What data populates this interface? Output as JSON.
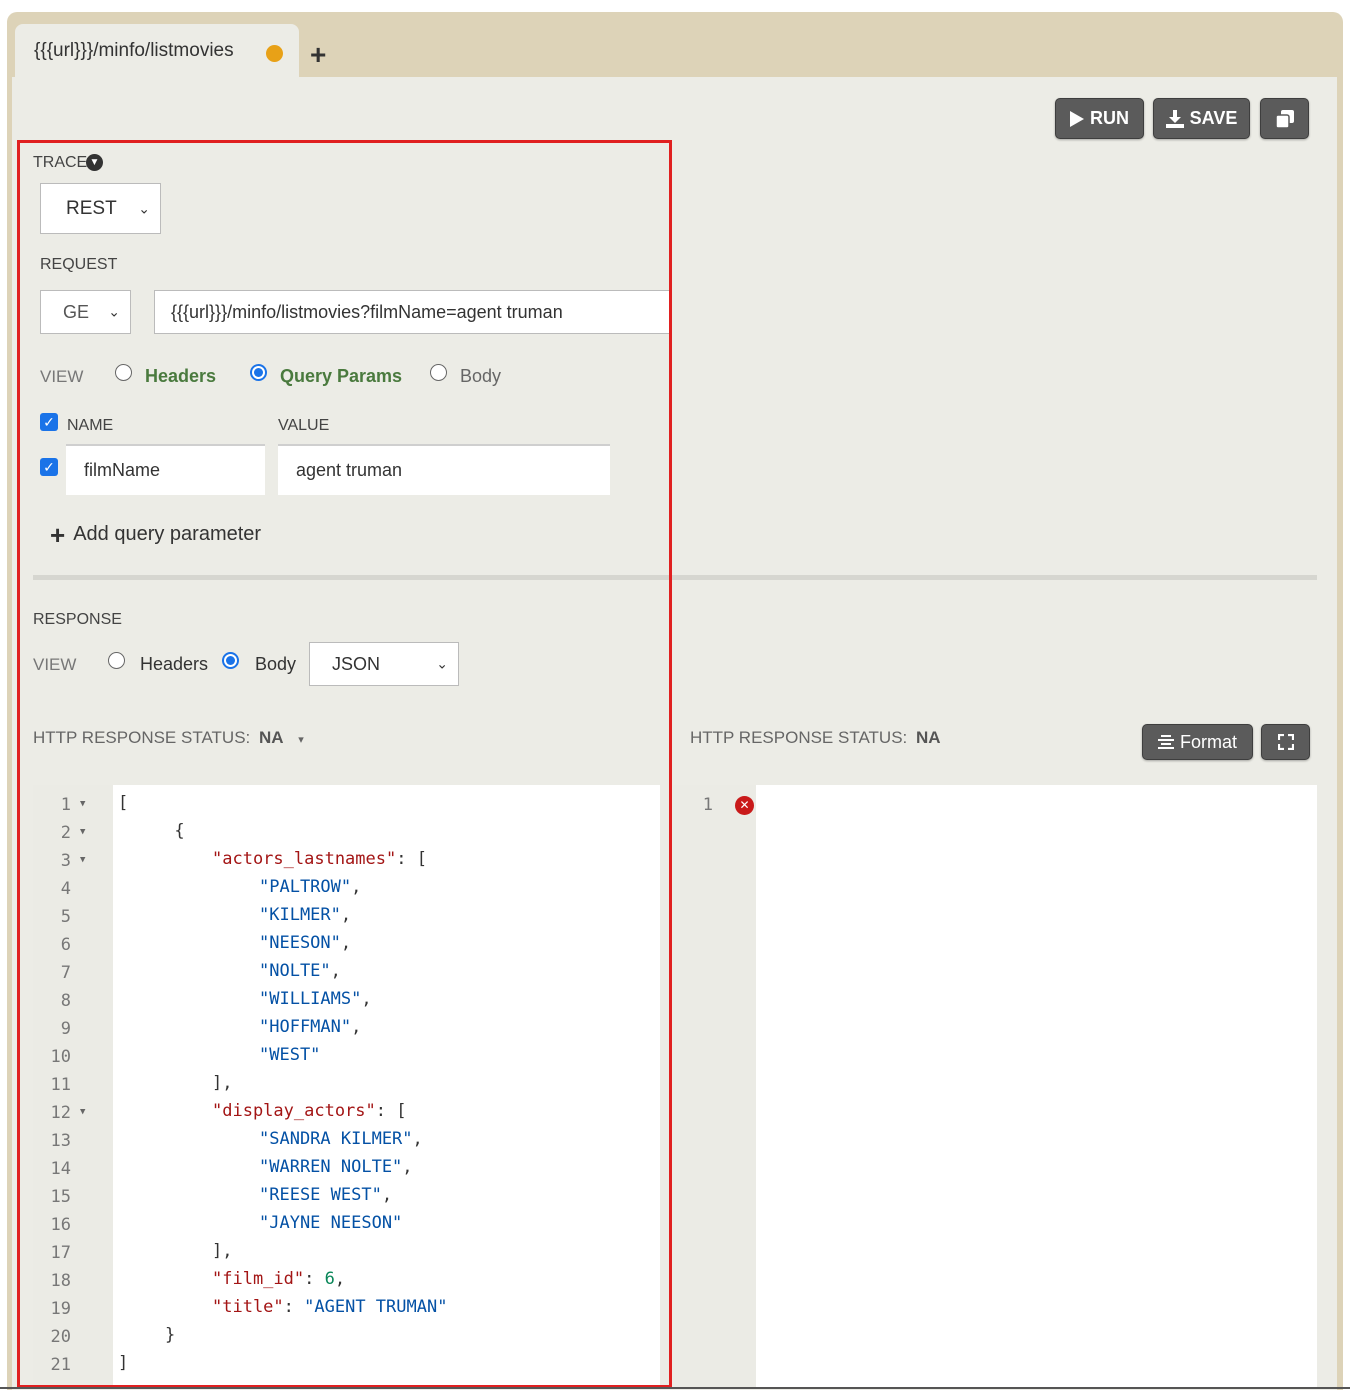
{
  "tabs": {
    "active_label": "{{{url}}}/minfo/listmovies",
    "add_label": "+"
  },
  "toolbar": {
    "run_label": "RUN",
    "save_label": "SAVE"
  },
  "trace": {
    "label": "TRACE",
    "protocol_selected": "REST"
  },
  "request": {
    "label": "REQUEST",
    "method_selected": "GE",
    "url_value": "{{{url}}}/minfo/listmovies?filmName=agent truman",
    "view_label": "VIEW",
    "view_options": [
      "Headers",
      "Query Params",
      "Body"
    ],
    "view_selected": "Query Params",
    "params": {
      "name_header": "NAME",
      "value_header": "VALUE",
      "rows": [
        {
          "name": "filmName",
          "value": "agent truman",
          "enabled": true
        }
      ],
      "add_label": "Add query parameter"
    }
  },
  "response": {
    "label": "RESPONSE",
    "view_label": "VIEW",
    "view_options": [
      "Headers",
      "Body"
    ],
    "view_selected": "Body",
    "format_selected": "JSON",
    "status_label": "HTTP RESPONSE STATUS:",
    "status_value": "NA",
    "status_caret": "▾",
    "right_status_label": "HTTP RESPONSE STATUS:",
    "right_status_value": "NA",
    "format_button": "Format",
    "right_line_number": "1"
  },
  "editor_lines": [
    {
      "n": "1",
      "fold": true
    },
    {
      "n": "2",
      "fold": true
    },
    {
      "n": "3",
      "fold": true
    },
    {
      "n": "4"
    },
    {
      "n": "5"
    },
    {
      "n": "6"
    },
    {
      "n": "7"
    },
    {
      "n": "8"
    },
    {
      "n": "9"
    },
    {
      "n": "10"
    },
    {
      "n": "11"
    },
    {
      "n": "12",
      "fold": true
    },
    {
      "n": "13"
    },
    {
      "n": "14"
    },
    {
      "n": "15"
    },
    {
      "n": "16"
    },
    {
      "n": "17"
    },
    {
      "n": "18"
    },
    {
      "n": "19"
    },
    {
      "n": "20"
    },
    {
      "n": "21"
    }
  ],
  "code": {
    "l1": "[",
    "l2": "{",
    "key_actors_lastnames": "\"actors_lastnames\"",
    "l3_tail": ": [",
    "actors_lastnames": [
      "\"PALTROW\"",
      "\"KILMER\"",
      "\"NEESON\"",
      "\"NOLTE\"",
      "\"WILLIAMS\"",
      "\"HOFFMAN\"",
      "\"WEST\""
    ],
    "comma": ",",
    "l11": "],",
    "key_display_actors": "\"display_actors\"",
    "l12_tail": ": [",
    "display_actors": [
      "\"SANDRA KILMER\"",
      "\"WARREN NOLTE\"",
      "\"REESE WEST\"",
      "\"JAYNE NEESON\""
    ],
    "l17": "],",
    "key_film_id": "\"film_id\"",
    "colon": ": ",
    "film_id": "6",
    "key_title": "\"title\"",
    "title": "\"AGENT TRUMAN\"",
    "l20": "}",
    "l21": "]"
  }
}
